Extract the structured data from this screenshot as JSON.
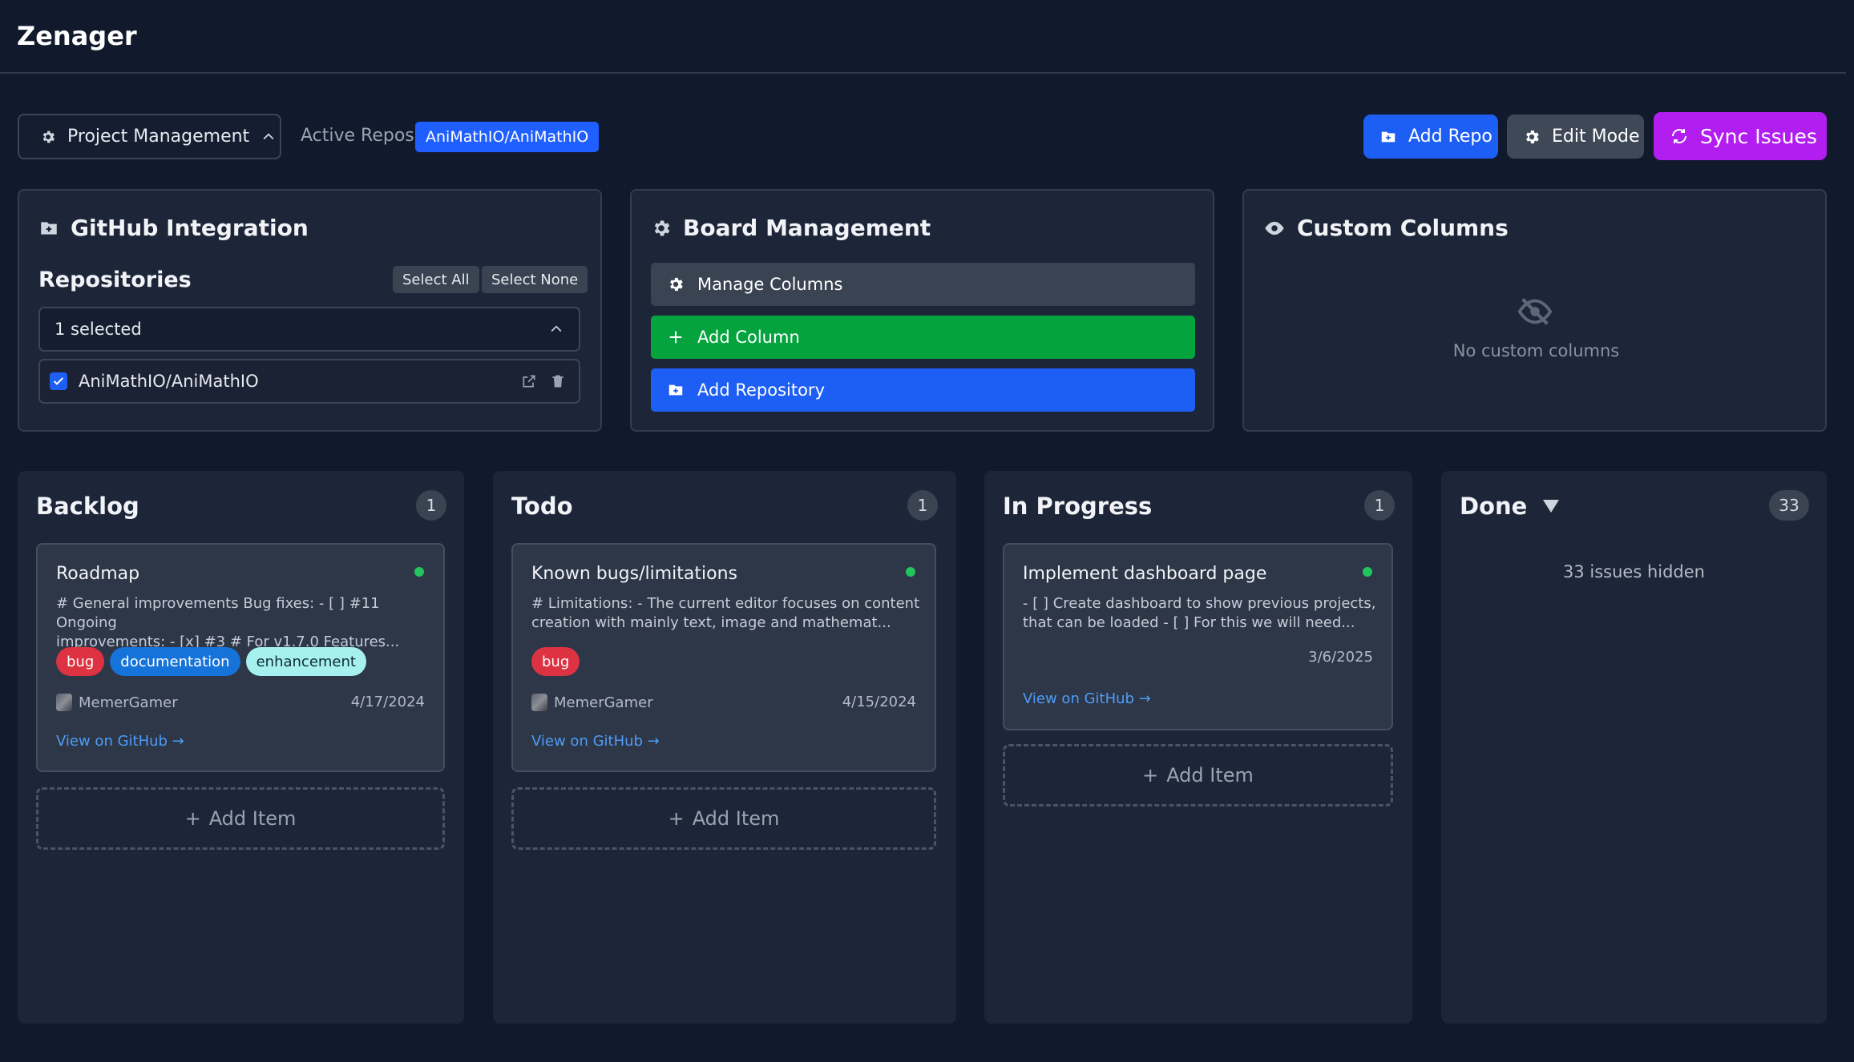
{
  "app": {
    "title": "Zenager"
  },
  "toolbar": {
    "project_label": "Project Management",
    "active_repos_label": "Active Repos:",
    "active_repo": "AniMathIO/AniMathIO",
    "add_repo_label": "Add Repo",
    "edit_mode_label": "Edit Mode",
    "sync_issues_label": "Sync Issues"
  },
  "github_panel": {
    "title": "GitHub Integration",
    "section_title": "Repositories",
    "select_all_label": "Select All",
    "select_none_label": "Select None",
    "selected_text": "1 selected",
    "repos": [
      {
        "name": "AniMathIO/AniMathIO",
        "checked": true
      }
    ]
  },
  "board_panel": {
    "title": "Board Management",
    "manage_columns_label": "Manage Columns",
    "add_column_label": "Add Column",
    "add_repository_label": "Add Repository"
  },
  "custom_panel": {
    "title": "Custom Columns",
    "empty_text": "No custom columns"
  },
  "columns": [
    {
      "title": "Backlog",
      "count": "1",
      "card": {
        "title": "Roadmap",
        "body_line1": "# General improvements Bug fixes: - [ ] #11 Ongoing",
        "body_line2": "improvements: - [x] #3 # For v1.7.0 Features...",
        "tags": [
          "bug",
          "documentation",
          "enhancement"
        ],
        "author": "MemerGamer",
        "date": "4/17/2024",
        "link": "View on GitHub →"
      },
      "add_label": "Add Item"
    },
    {
      "title": "Todo",
      "count": "1",
      "card": {
        "title": "Known bugs/limitations",
        "body_line1": "# Limitations: - The current editor focuses on content",
        "body_line2": "creation with mainly text, image and mathemat...",
        "tags": [
          "bug"
        ],
        "author": "MemerGamer",
        "date": "4/15/2024",
        "link": "View on GitHub →"
      },
      "add_label": "Add Item"
    },
    {
      "title": "In Progress",
      "count": "1",
      "card": {
        "title": "Implement dashboard page",
        "body_line1": "- [ ] Create dashboard to show previous projects,",
        "body_line2": "that can be loaded - [ ] For this we will need...",
        "date": "3/6/2025",
        "link": "View on GitHub →"
      },
      "add_label": "Add Item"
    },
    {
      "title": "Done",
      "count": "33",
      "hidden_text": "33 issues hidden"
    }
  ],
  "colors": {
    "background": "#111a2c",
    "panel": "#1d2638",
    "card": "#2d3748",
    "primary_blue": "#1d5ef5",
    "success_green": "#04a33e",
    "sync_purple": "#b21ef0",
    "link_blue": "#4f9cf7",
    "status_dot": "#22c55e"
  },
  "icons": {
    "project": "gear-icon",
    "add_repo": "folder-plus-icon",
    "edit_mode": "gear-icon",
    "sync": "refresh-icon",
    "github_panel": "folder-plus-icon",
    "board_panel": "gear-icon",
    "custom_panel": "eye-icon",
    "custom_empty": "eye-off-icon",
    "repo_open": "external-link-icon",
    "repo_delete": "trash-icon",
    "done_toggle": "triangle-down-icon"
  }
}
